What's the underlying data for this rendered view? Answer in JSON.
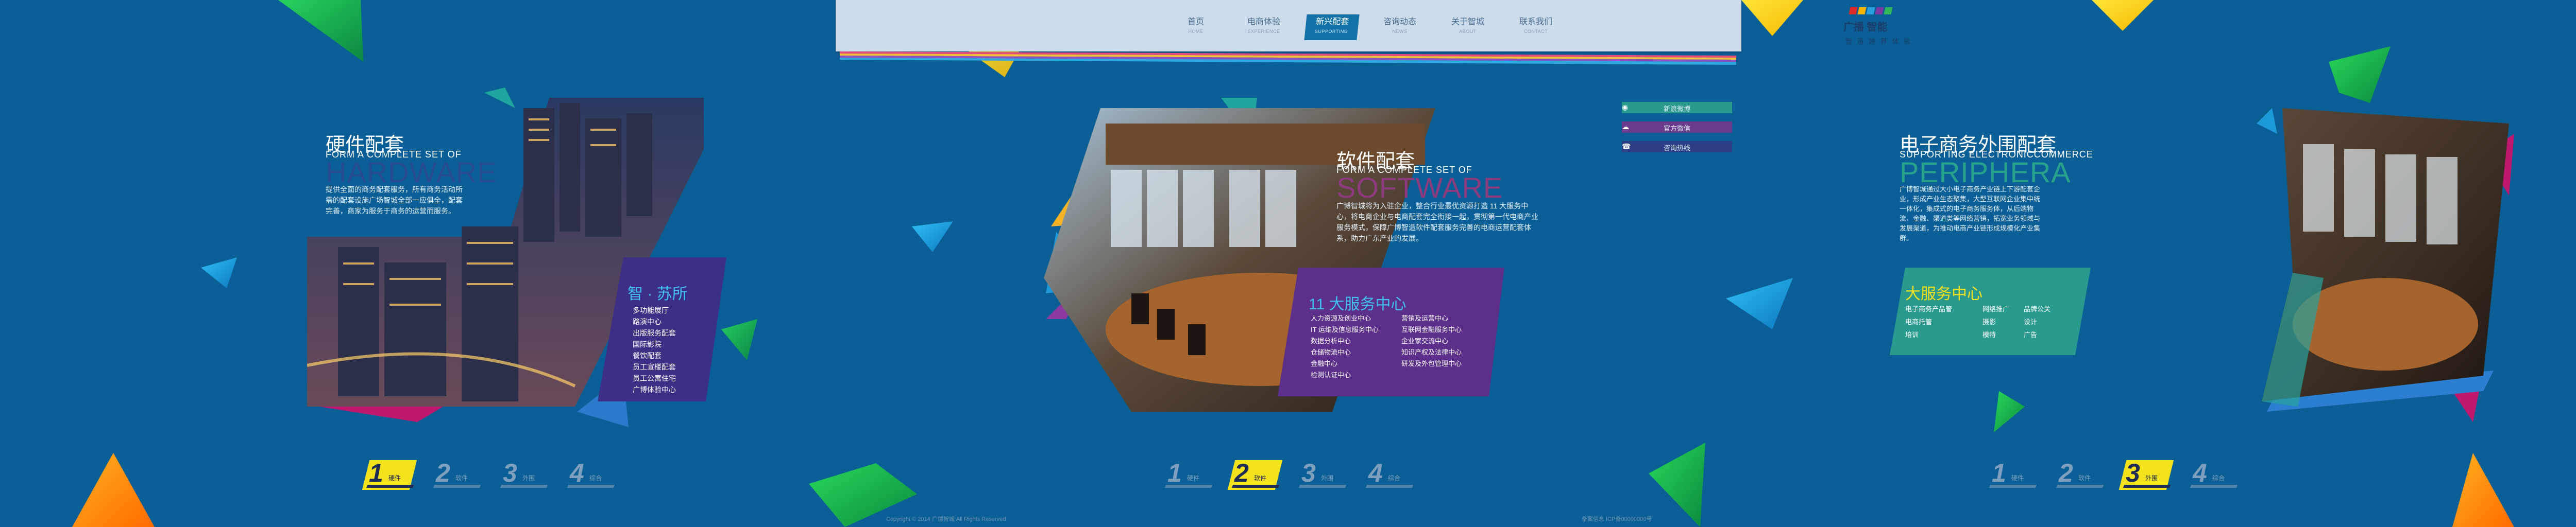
{
  "colors": {
    "background": "#0b5f97",
    "accent_yellow": "#f4e21a",
    "purple": "#5b2f8a",
    "teal": "#2aa39e",
    "magenta": "#c0176f"
  },
  "logo": {
    "title": "广播 智能",
    "subtitle": "智 造 跨 界 体 验"
  },
  "nav": [
    {
      "zh": "首页",
      "en": "HOME"
    },
    {
      "zh": "电商体验",
      "en": "EXPERIENCE"
    },
    {
      "zh": "新兴配套",
      "en": "SUPPORTING",
      "active": true
    },
    {
      "zh": "咨询动态",
      "en": "NEWS"
    },
    {
      "zh": "关于智城",
      "en": "ABOUT"
    },
    {
      "zh": "联系我们",
      "en": "CONTACT"
    }
  ],
  "side_links": [
    {
      "icon": "weibo-icon",
      "label": "新浪微博"
    },
    {
      "icon": "wechat-icon",
      "label": "官方微信"
    },
    {
      "icon": "phone-icon",
      "label": "咨询热线"
    }
  ],
  "panel1": {
    "title_zh": "硬件配套",
    "title_en": "FORM A COMPLETE SET OF",
    "big_en": "HARDWARE",
    "desc": "提供全面的商务配套服务，所有商务活动所需的配套设施广场智城全部一应俱全，配套完善，商家为服务于商务的运营而服务。",
    "box_title": "智 · 苏所",
    "box_items": [
      "多功能展厅",
      "路演中心",
      "出版服务配套",
      "国际影院",
      "餐饮配套",
      "员工宣楼配套",
      "员工公寓住宅",
      "广博体验中心"
    ],
    "steps": [
      {
        "num": "1",
        "label": "硬件"
      },
      {
        "num": "2",
        "label": "软件"
      },
      {
        "num": "3",
        "label": "外围"
      },
      {
        "num": "4",
        "label": "综合"
      }
    ],
    "active_step": 0
  },
  "panel2": {
    "title_zh": "软件配套",
    "title_en": "FORM A COMPLETE SET OF",
    "big_en": "SOFTWARE",
    "desc": "广博智城将为入驻企业，整合行业最优资源打造 11 大服务中心，将电商企业与电商配套完全衔接一起，贯彻第一代电商产业服务模式，保障广博智造软件配套服务完善的电商运营配套体系，助力广东产业的发展。",
    "box_title": "11 大服务中心",
    "box_col1": [
      "人力资源及创业中心",
      "IT 运维及信息服务中心",
      "数据分析中心",
      "仓储物流中心",
      "金融中心",
      "检测认证中心"
    ],
    "box_col2": [
      "营销及运营中心",
      "互联网金融服务中心",
      "企业家交流中心",
      "知识产权及法律中心",
      "研发及外包管理中心"
    ],
    "steps": [
      {
        "num": "1",
        "label": "硬件"
      },
      {
        "num": "2",
        "label": "软件"
      },
      {
        "num": "3",
        "label": "外围"
      },
      {
        "num": "4",
        "label": "综合"
      }
    ],
    "active_step": 1,
    "footer": "Copyright © 2014 广博智城 All Rights Reserved"
  },
  "panel3": {
    "title_zh": "电子商务外围配套",
    "title_en": "SUPPORTING ELECTRONICCOMMERCE",
    "big_en": "PERIPHERA",
    "desc": "广博智城通过大小电子商务产业链上下游配套企业，形成产业生态聚集，大型互联网企业集中统一体化，集成式的电子商务服务体，从后端物流、金融、渠道类等网络营销，拓宽业务领域与发展渠道，为推动电商产业链形成规模化产业集群。",
    "box_title": "大服务中心",
    "box_items": [
      "电子商务产品管",
      "网络推广",
      "品牌公关",
      "电商托管",
      "摄影",
      "设计",
      "培训",
      "模特",
      "广告"
    ],
    "steps": [
      {
        "num": "1",
        "label": "硬件"
      },
      {
        "num": "2",
        "label": "软件"
      },
      {
        "num": "3",
        "label": "外围"
      },
      {
        "num": "4",
        "label": "综合"
      }
    ],
    "active_step": 2,
    "footer": "备案信息 ICP备00000000号"
  }
}
